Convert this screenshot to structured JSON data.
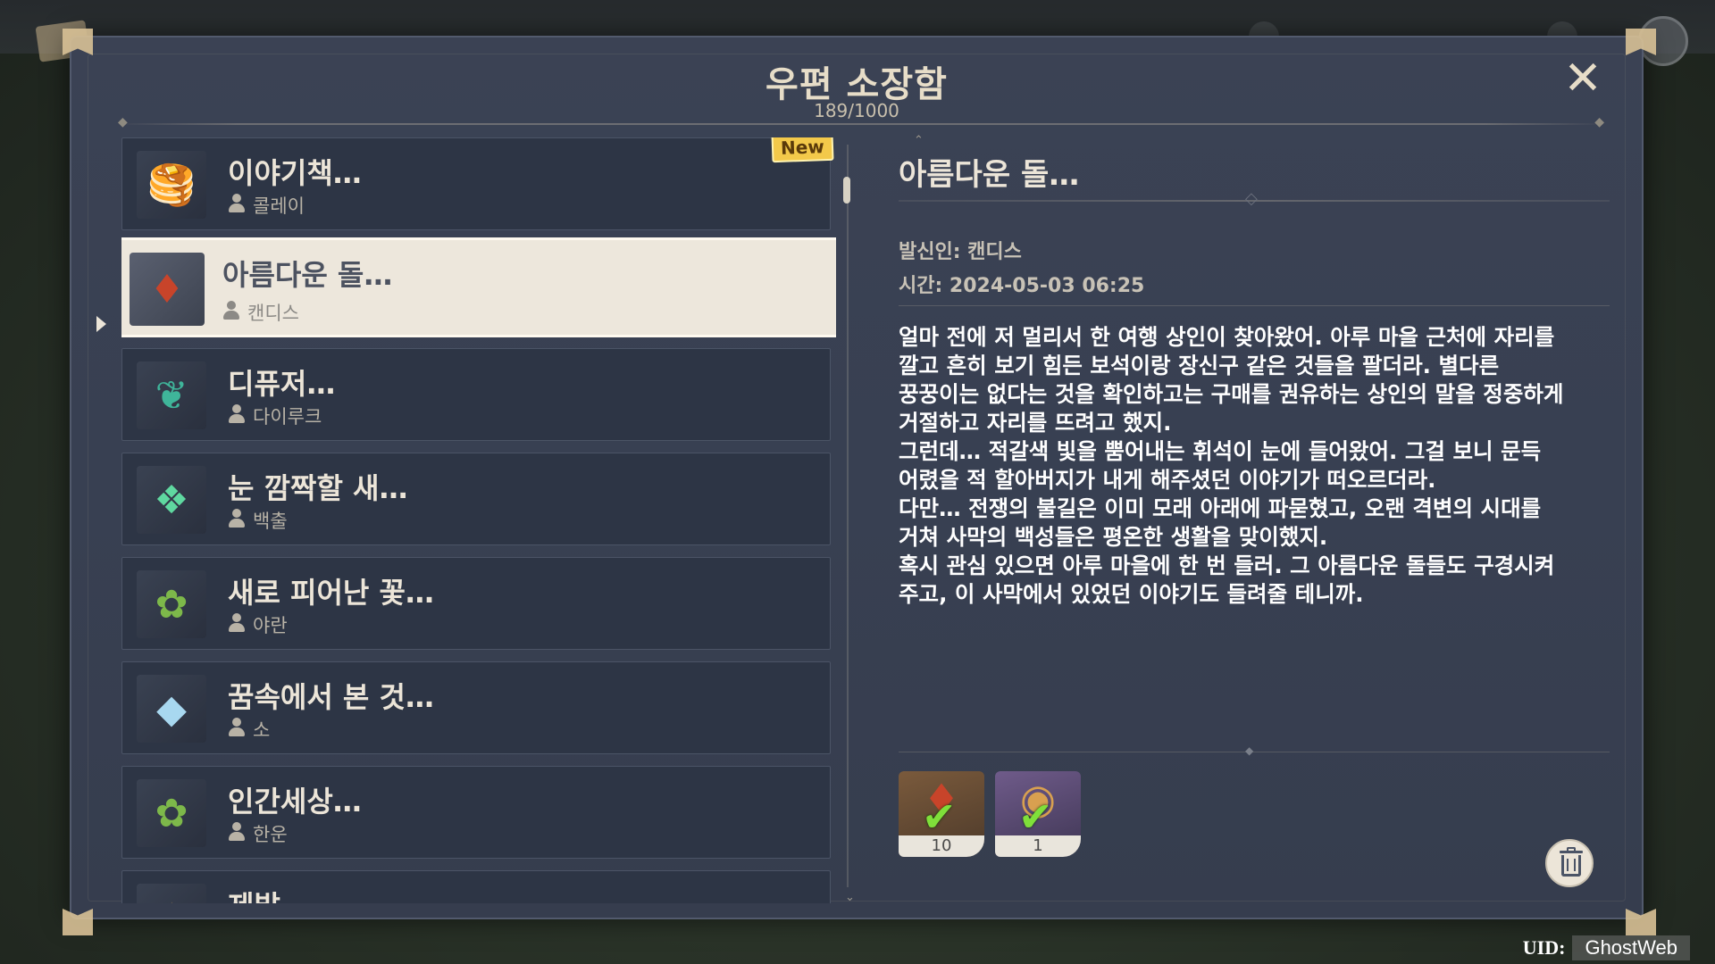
{
  "mailbox": {
    "title": "우편 소장함",
    "count": "189/1000",
    "close_label": "✕"
  },
  "mails": [
    {
      "title": "이야기책…",
      "sender": "콜레이",
      "icon": "pancake-icon",
      "glyph": "🥞",
      "new": true,
      "badge": "New"
    },
    {
      "title": "아름다운 돌…",
      "sender": "캔디스",
      "icon": "red-gem-icon",
      "glyph": "♦",
      "selected": true
    },
    {
      "title": "디퓨저…",
      "sender": "다이루크",
      "icon": "diffuser-icon",
      "glyph": "❦"
    },
    {
      "title": "눈 깜짝할 새…",
      "sender": "백출",
      "icon": "green-crystal-icon",
      "glyph": "❖"
    },
    {
      "title": "새로 피어난 꽃…",
      "sender": "야란",
      "icon": "herb-letter-icon",
      "glyph": "✿"
    },
    {
      "title": "꿈속에서 본 것…",
      "sender": "소",
      "icon": "crystal-icon",
      "glyph": "◆"
    },
    {
      "title": "인간세상…",
      "sender": "한운",
      "icon": "herb-letter-icon",
      "glyph": "✿"
    },
    {
      "title": "제발…",
      "sender": "",
      "icon": "gold-item-icon",
      "glyph": "✦"
    }
  ],
  "detail": {
    "title": "아름다운 돌…",
    "sender_line": "발신인: 캔디스",
    "time_line": "시간: 2024-05-03 06:25",
    "body": "얼마 전에 저 멀리서 한 여행 상인이 찾아왔어. 아루 마을 근처에 자리를\n깔고 흔히 보기 힘든 보석이랑 장신구 같은 것들을 팔더라. 별다른\n꿍꿍이는 없다는 것을 확인하고는 구매를 권유하는 상인의 말을 정중하게\n거절하고 자리를 뜨려고 했지.\n그런데… 적갈색 빛을 뿜어내는 휘석이 눈에 들어왔어. 그걸 보니 문득\n어렸을 적 할아버지가 내게 해주셨던 이야기가 떠오르더라.\n다만… 전쟁의 불길은 이미 모래 아래에 파묻혔고, 오랜 격변의 시대를\n거쳐 사막의 백성들은 평온한 생활을 맞이했지.\n혹시 관심 있으면 아루 마을에 한 번 들러. 그 아름다운 돌들도 구경시켜\n주고, 이 사막에서 있었던 이야기도 들려줄 테니까.",
    "attachments": [
      {
        "icon": "red-gem-icon",
        "glyph": "♦",
        "qty": "10",
        "claimed": true,
        "rarity_color": "#7a5a3c"
      },
      {
        "icon": "food-dish-icon",
        "glyph": "◉",
        "qty": "1",
        "claimed": true,
        "rarity_color": "#6f5b8a"
      }
    ]
  },
  "footer": {
    "uid_label": "UID:",
    "uid_value": "GhostWeb"
  },
  "colors": {
    "panel": "#3b4254",
    "item_bg": "#2d3545",
    "selected_bg": "#ede7dc",
    "accent_gold": "#f3c94a",
    "check_green": "#7fe03a"
  }
}
